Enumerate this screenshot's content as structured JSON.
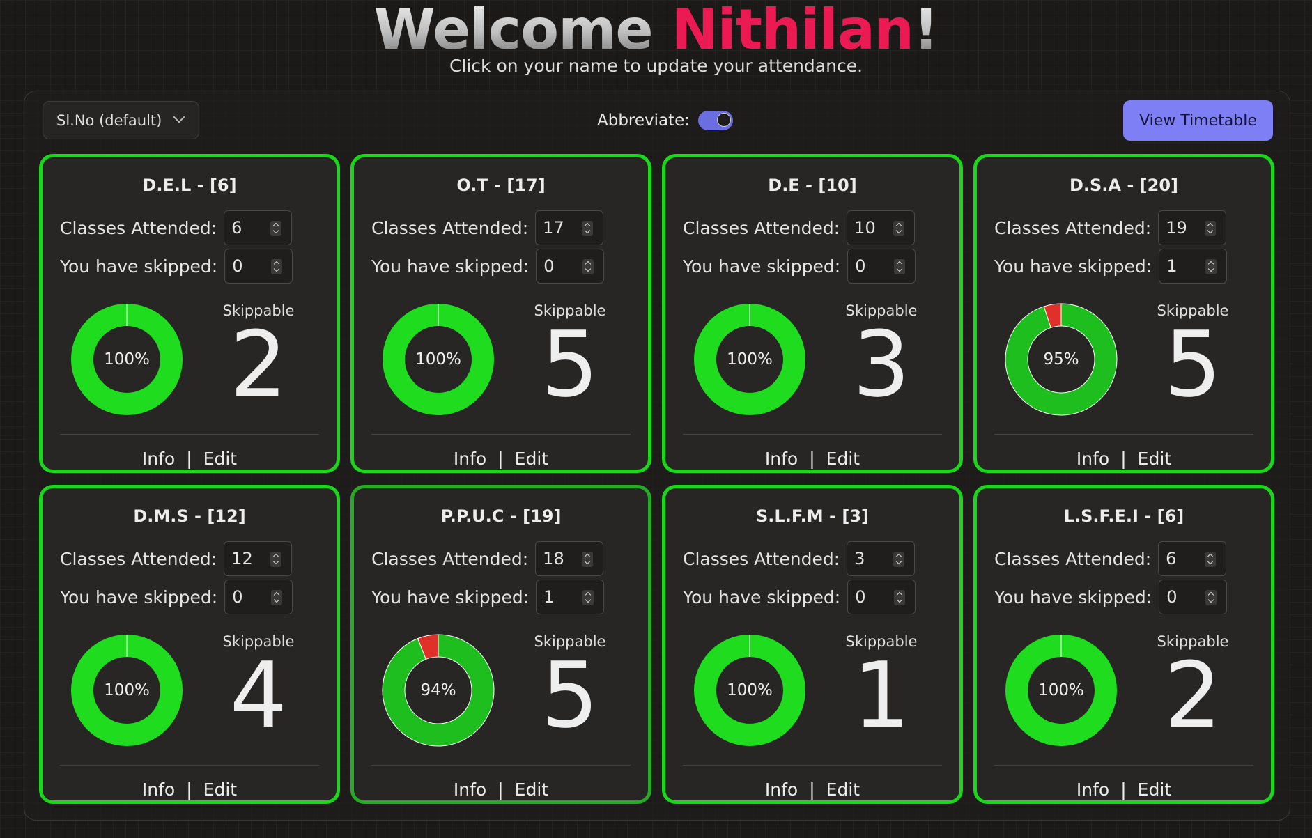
{
  "header": {
    "welcome": "Welcome",
    "name": "Nithilan",
    "exclaim": "!",
    "subtitle": "Click on your name to update your attendance."
  },
  "toolbar": {
    "sort_label": "Sl.No (default)",
    "abbreviate_label": "Abbreviate:",
    "abbreviate_on": true,
    "timetable_button": "View Timetable"
  },
  "labels": {
    "attended": "Classes Attended:",
    "skipped": "You have skipped:",
    "skippable": "Skippable",
    "info": "Info",
    "separator": "|",
    "edit": "Edit"
  },
  "colors": {
    "accent_pink": "#ec1a53",
    "card_border": "#1bd61b",
    "donut_green": "#1fdc1f",
    "donut_green_partial": "#1fbe1f",
    "donut_red": "#e0302a",
    "button": "#7f7ff5"
  },
  "subjects": [
    {
      "title": "D.E.L - [6]",
      "attended": "6",
      "skipped": "0",
      "percent_label": "100%",
      "percent": 100,
      "skippable": "2"
    },
    {
      "title": "O.T - [17]",
      "attended": "17",
      "skipped": "0",
      "percent_label": "100%",
      "percent": 100,
      "skippable": "5"
    },
    {
      "title": "D.E - [10]",
      "attended": "10",
      "skipped": "0",
      "percent_label": "100%",
      "percent": 100,
      "skippable": "3"
    },
    {
      "title": "D.S.A - [20]",
      "attended": "19",
      "skipped": "1",
      "percent_label": "95%",
      "percent": 95,
      "skippable": "5"
    },
    {
      "title": "D.M.S - [12]",
      "attended": "12",
      "skipped": "0",
      "percent_label": "100%",
      "percent": 100,
      "skippable": "4"
    },
    {
      "title": "P.P.U.C - [19]",
      "attended": "18",
      "skipped": "1",
      "percent_label": "94%",
      "percent": 94,
      "skippable": "5"
    },
    {
      "title": "S.L.F.M - [3]",
      "attended": "3",
      "skipped": "0",
      "percent_label": "100%",
      "percent": 100,
      "skippable": "1"
    },
    {
      "title": "L.S.F.E.I - [6]",
      "attended": "6",
      "skipped": "0",
      "percent_label": "100%",
      "percent": 100,
      "skippable": "2"
    }
  ]
}
